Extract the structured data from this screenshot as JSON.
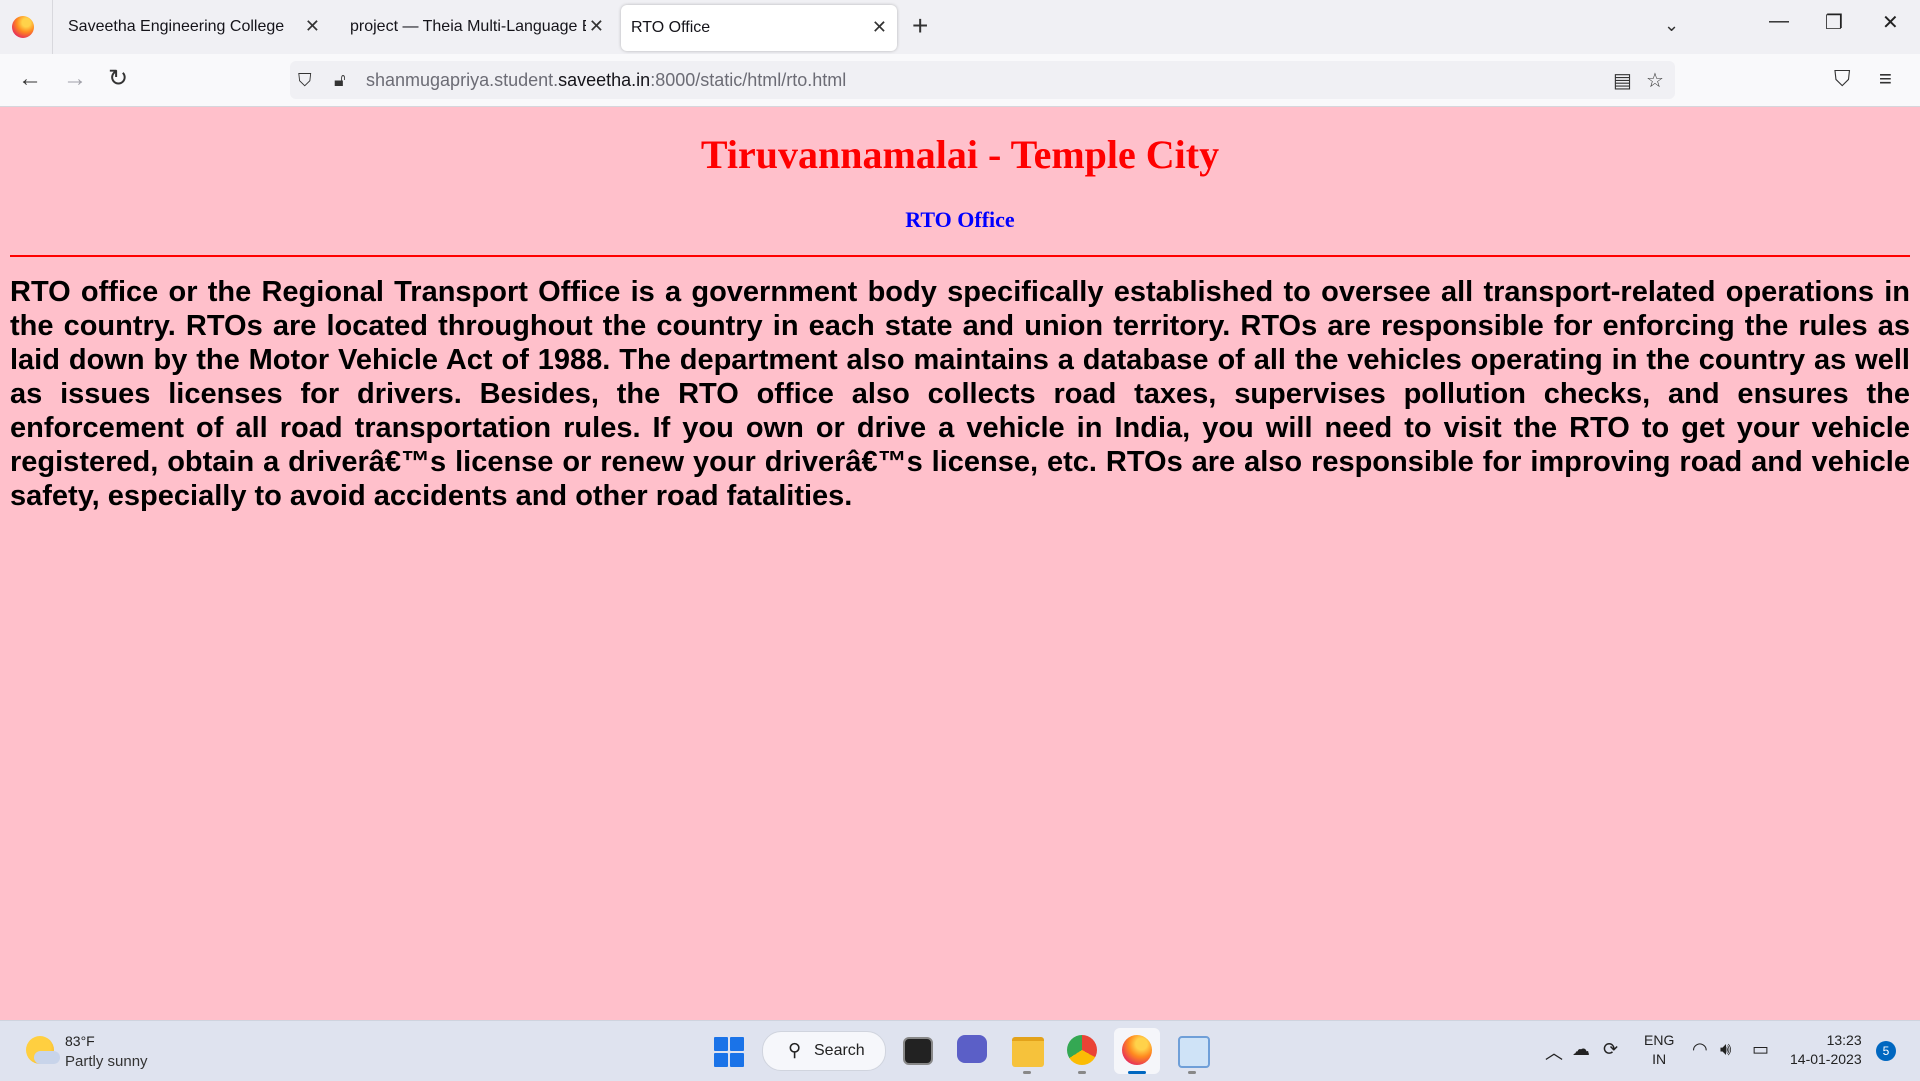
{
  "browser": {
    "tabs": [
      {
        "label": "Saveetha Engineering College",
        "active": false
      },
      {
        "label": "project — Theia Multi-Language Ex",
        "active": false
      },
      {
        "label": "RTO Office",
        "active": true
      }
    ],
    "url": {
      "prefix": "shanmugapriya.student.",
      "host": "saveetha.in",
      "suffix": ":8000/static/html/rto.html"
    }
  },
  "page": {
    "title": "Tiruvannamalai - Temple City",
    "subtitle": "RTO Office",
    "body": "RTO office or the Regional Transport Office is a government body specifically established to oversee all transport-related operations in the country. RTOs are located throughout the country in each state and union territory. RTOs are responsible for enforcing the rules as laid down by the Motor Vehicle Act of 1988. The department also maintains a database of all the vehicles operating in the country as well as issues licenses for drivers. Besides, the RTO office also collects road taxes, supervises pollution checks, and ensures the enforcement of all road transportation rules. If you own or drive a vehicle in India, you will need to visit the RTO to get your vehicle registered, obtain a driverâ€™s license or renew your driverâ€™s license, etc. RTOs are also responsible for improving road and vehicle safety, especially to avoid accidents and other road fatalities.",
    "colors": {
      "background": "#ffc0cb",
      "title": "#ff0000",
      "subtitle": "#0000ff",
      "rule": "#ff0000"
    }
  },
  "taskbar": {
    "weather": {
      "temp": "83°F",
      "desc": "Partly sunny"
    },
    "search_label": "Search",
    "lang_top": "ENG",
    "lang_bottom": "IN",
    "time": "13:23",
    "date": "14-01-2023",
    "notification_count": "5"
  }
}
